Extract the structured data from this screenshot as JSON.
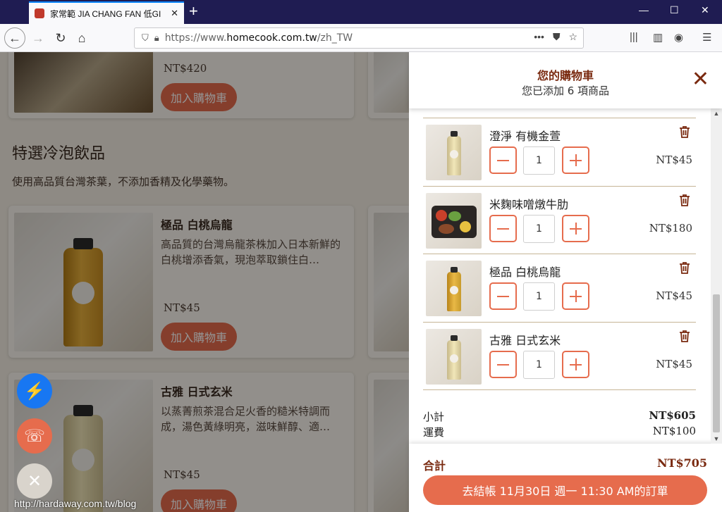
{
  "browser": {
    "tab_title": "家常範 JIA CHANG FAN 低GI",
    "url_prefix": "https://www.",
    "url_domain": "homecook.com.tw",
    "url_path": "/zh_TW"
  },
  "menu": {
    "top_card": {
      "price": "NT$420",
      "add_label": "加入購物車"
    },
    "section_title": "特選冷泡飲品",
    "section_subtitle": "使用高品質台灣茶葉，不添加香精及化學藥物。",
    "products": [
      {
        "name": "極品 白桃烏龍",
        "description": "高品質的台灣烏龍茶株加入日本新鮮的白桃增添香氣，現泡萃取鎖住白…",
        "price": "NT$45",
        "add_label": "加入購物車"
      },
      {
        "name": "古雅 日式玄米",
        "description": "以蒸菁煎茶混合足火香的糙米特調而成，湯色黃綠明亮，滋味鮮醇、適…",
        "price": "NT$45",
        "add_label": "加入購物車"
      }
    ]
  },
  "watermark": "http://hardaway.com.tw/blog",
  "cart": {
    "title": "您的購物車",
    "subtitle": "您已添加 6 項商品",
    "items": [
      {
        "name": "澄淨 有機金萱",
        "qty": "1",
        "price": "NT$45"
      },
      {
        "name": "米麴味噌燉牛肋",
        "qty": "1",
        "price": "NT$180"
      },
      {
        "name": "極品 白桃烏龍",
        "qty": "1",
        "price": "NT$45"
      },
      {
        "name": "古雅 日式玄米",
        "qty": "1",
        "price": "NT$45"
      }
    ],
    "subtotal_label": "小計",
    "subtotal": "NT$605",
    "shipping_label": "運費",
    "shipping": "NT$100",
    "total_label": "合計",
    "total": "NT$705",
    "checkout_label": "去結帳 11月30日 週一 11:30 AM的訂單"
  },
  "colors": {
    "accent": "#e66c4d",
    "brand_dark": "#7a2a10",
    "browser_tabbar": "#1f1c52"
  }
}
